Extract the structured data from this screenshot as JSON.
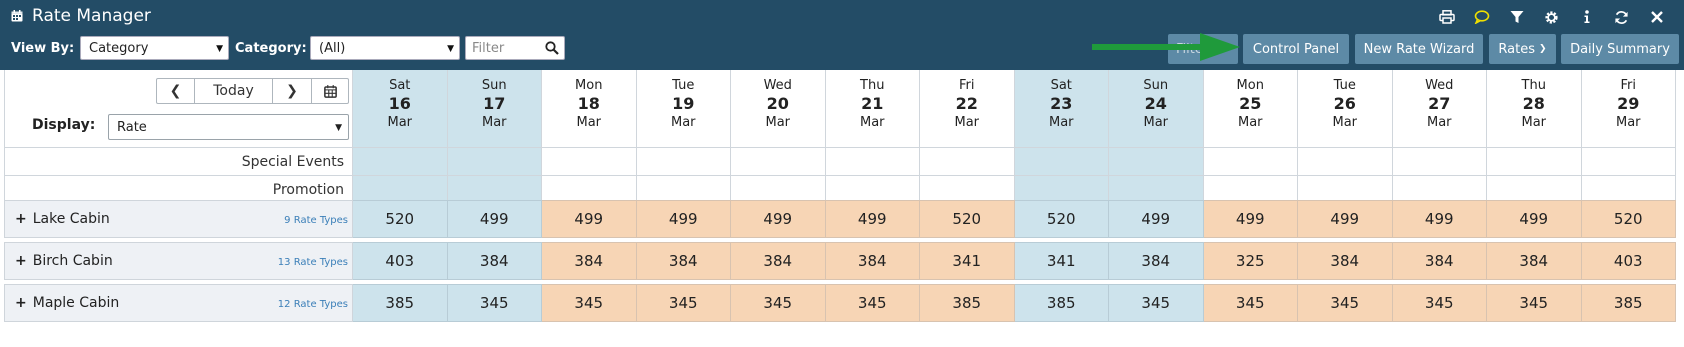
{
  "header": {
    "title": "Rate Manager",
    "icons": [
      "print-icon",
      "comment-icon",
      "filter-icon",
      "gear-icon",
      "info-icon",
      "refresh-icon",
      "close-icon"
    ]
  },
  "controls": {
    "view_by_label": "View By:",
    "view_by_value": "Category",
    "category_label": "Category:",
    "category_value": "(All)",
    "filter_placeholder": "Filter",
    "hidden_button_label": "Filter",
    "buttons": [
      "Control Panel",
      "New Rate Wizard",
      "Rates",
      "Daily Summary"
    ],
    "arrow_color": "#1f9a3b"
  },
  "navigation": {
    "today_label": "Today",
    "display_label": "Display:",
    "display_value": "Rate"
  },
  "dates": [
    {
      "dow": "Sat",
      "day": "16",
      "month": "Mar",
      "weekend": true
    },
    {
      "dow": "Sun",
      "day": "17",
      "month": "Mar",
      "weekend": true
    },
    {
      "dow": "Mon",
      "day": "18",
      "month": "Mar",
      "weekend": false
    },
    {
      "dow": "Tue",
      "day": "19",
      "month": "Mar",
      "weekend": false
    },
    {
      "dow": "Wed",
      "day": "20",
      "month": "Mar",
      "weekend": false
    },
    {
      "dow": "Thu",
      "day": "21",
      "month": "Mar",
      "weekend": false
    },
    {
      "dow": "Fri",
      "day": "22",
      "month": "Mar",
      "weekend": false
    },
    {
      "dow": "Sat",
      "day": "23",
      "month": "Mar",
      "weekend": true
    },
    {
      "dow": "Sun",
      "day": "24",
      "month": "Mar",
      "weekend": true
    },
    {
      "dow": "Mon",
      "day": "25",
      "month": "Mar",
      "weekend": false
    },
    {
      "dow": "Tue",
      "day": "26",
      "month": "Mar",
      "weekend": false
    },
    {
      "dow": "Wed",
      "day": "27",
      "month": "Mar",
      "weekend": false
    },
    {
      "dow": "Thu",
      "day": "28",
      "month": "Mar",
      "weekend": false
    },
    {
      "dow": "Fri",
      "day": "29",
      "month": "Mar",
      "weekend": false
    }
  ],
  "event_rows": [
    "Special Events",
    "Promotion"
  ],
  "rate_rows": [
    {
      "name": "Lake Cabin",
      "rate_types": "9 Rate Types",
      "rates": [
        "520",
        "499",
        "499",
        "499",
        "499",
        "499",
        "520",
        "520",
        "499",
        "499",
        "499",
        "499",
        "499",
        "520"
      ]
    },
    {
      "name": "Birch Cabin",
      "rate_types": "13 Rate Types",
      "rates": [
        "403",
        "384",
        "384",
        "384",
        "384",
        "384",
        "341",
        "341",
        "384",
        "325",
        "384",
        "384",
        "384",
        "403"
      ]
    },
    {
      "name": "Maple Cabin",
      "rate_types": "12 Rate Types",
      "rates": [
        "385",
        "345",
        "345",
        "345",
        "345",
        "345",
        "385",
        "385",
        "345",
        "345",
        "345",
        "345",
        "345",
        "385"
      ]
    }
  ]
}
